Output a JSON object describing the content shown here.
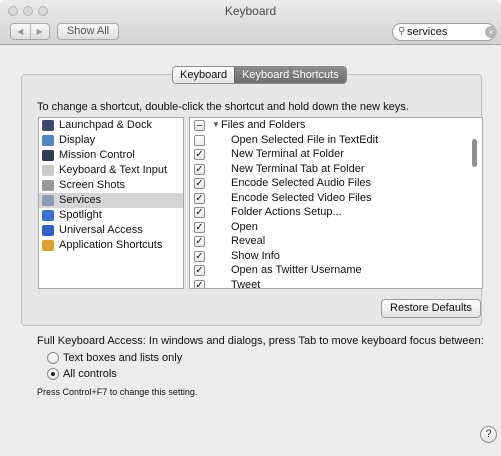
{
  "window": {
    "title": "Keyboard",
    "show_all_label": "Show All",
    "nav_back_icon": "back-arrow-icon",
    "nav_forward_icon": "forward-arrow-icon"
  },
  "search": {
    "value": "services",
    "placeholder": ""
  },
  "tabs": [
    {
      "label": "Keyboard"
    },
    {
      "label": "Keyboard Shortcuts"
    }
  ],
  "instructions": "To change a shortcut, double-click the shortcut and hold down the new keys.",
  "categories": [
    {
      "label": "Launchpad & Dock",
      "icon": "launchpad-icon",
      "color": "#3a4a6a"
    },
    {
      "label": "Display",
      "icon": "display-icon",
      "color": "#4f86c6"
    },
    {
      "label": "Mission Control",
      "icon": "mission-control-icon",
      "color": "#2b3b55"
    },
    {
      "label": "Keyboard & Text Input",
      "icon": "keyboard-icon",
      "color": "#c9c9c9"
    },
    {
      "label": "Screen Shots",
      "icon": "screenshot-icon",
      "color": "#9a9a9a"
    },
    {
      "label": "Services",
      "icon": "services-icon",
      "color": "#8a9bb5"
    },
    {
      "label": "Spotlight",
      "icon": "spotlight-icon",
      "color": "#3b6fd1"
    },
    {
      "label": "Universal Access",
      "icon": "universal-access-icon",
      "color": "#2f62c8"
    },
    {
      "label": "Application Shortcuts",
      "icon": "app-shortcuts-icon",
      "color": "#e0a030"
    }
  ],
  "shortcut_group": {
    "label": "Files and Folders",
    "state": "mixed",
    "mixed_glyph": "–"
  },
  "shortcuts": [
    {
      "label": "Open Selected File in TextEdit",
      "checked": false
    },
    {
      "label": "New Terminal at Folder",
      "checked": true
    },
    {
      "label": "New Terminal Tab at Folder",
      "checked": true
    },
    {
      "label": "Encode Selected Audio Files",
      "checked": true
    },
    {
      "label": "Encode Selected Video Files",
      "checked": true
    },
    {
      "label": "Folder Actions Setup...",
      "checked": true
    },
    {
      "label": "Open",
      "checked": true
    },
    {
      "label": "Reveal",
      "checked": true
    },
    {
      "label": "Show Info",
      "checked": true
    },
    {
      "label": "Open as Twitter Username",
      "checked": true
    },
    {
      "label": "Tweet",
      "checked": true
    }
  ],
  "restore_defaults_label": "Restore Defaults",
  "full_keyboard_access": {
    "label": "Full Keyboard Access: In windows and dialogs, press Tab to move keyboard focus between:",
    "options": [
      {
        "label": "Text boxes and lists only",
        "selected": false
      },
      {
        "label": "All controls",
        "selected": true
      }
    ],
    "hint": "Press Control+F7 to change this setting."
  },
  "help_label": "?"
}
